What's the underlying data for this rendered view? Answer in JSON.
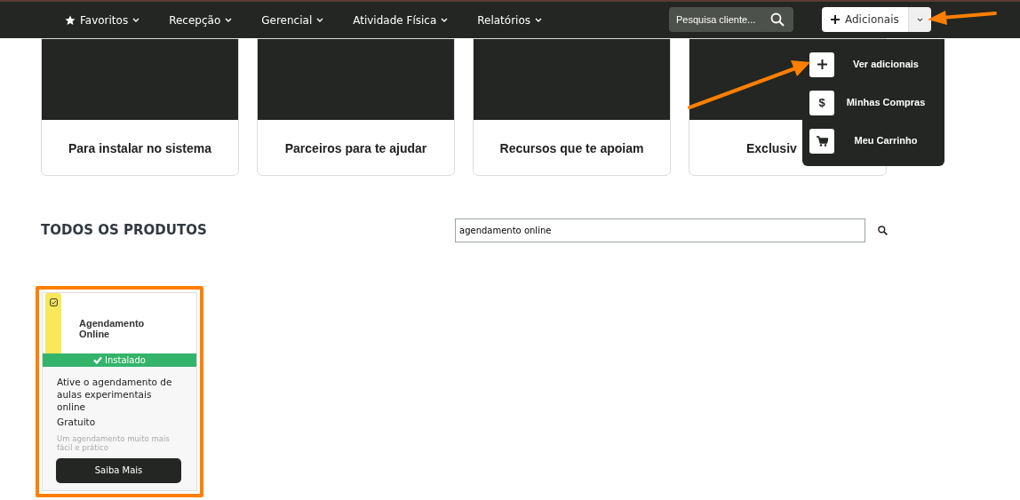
{
  "navbar": {
    "menus": [
      {
        "label": "Favoritos",
        "kind": "favorites"
      },
      {
        "label": "Recepção",
        "kind": "menu"
      },
      {
        "label": "Gerencial",
        "kind": "menu"
      },
      {
        "label": "Atividade Física",
        "kind": "menu"
      },
      {
        "label": "Relatórios",
        "kind": "menu"
      }
    ],
    "search": {
      "placeholder": "Pesquisa cliente..."
    },
    "addons_button": {
      "label": "Adicionais",
      "expanded": true
    }
  },
  "addons_menu": [
    {
      "label": "Ver adicionais",
      "kind": "plus"
    },
    {
      "label": "Minhas Compras",
      "kind": "symbol",
      "symbol": "$"
    },
    {
      "label": "Meu Carrinho",
      "kind": "cart"
    }
  ],
  "feature_cards": [
    {
      "caption": "Para instalar no sistema"
    },
    {
      "caption": "Parceiros para te ajudar"
    },
    {
      "caption": "Recursos que te apoiam"
    },
    {
      "caption": "Exclusiv"
    }
  ],
  "products_section": {
    "title": "TODOS OS PRODUTOS",
    "search": {
      "value": "agendamento online"
    },
    "products": [
      {
        "logo_text": "Agendamento Online",
        "installed": true,
        "status": "Instalado",
        "description": "Ative o agendamento de aulas experimentais online",
        "price": "Gratuito",
        "note": "Um agendamento muito mais fácil e prático",
        "button": "Saiba Mais",
        "highlighted": true
      }
    ]
  }
}
